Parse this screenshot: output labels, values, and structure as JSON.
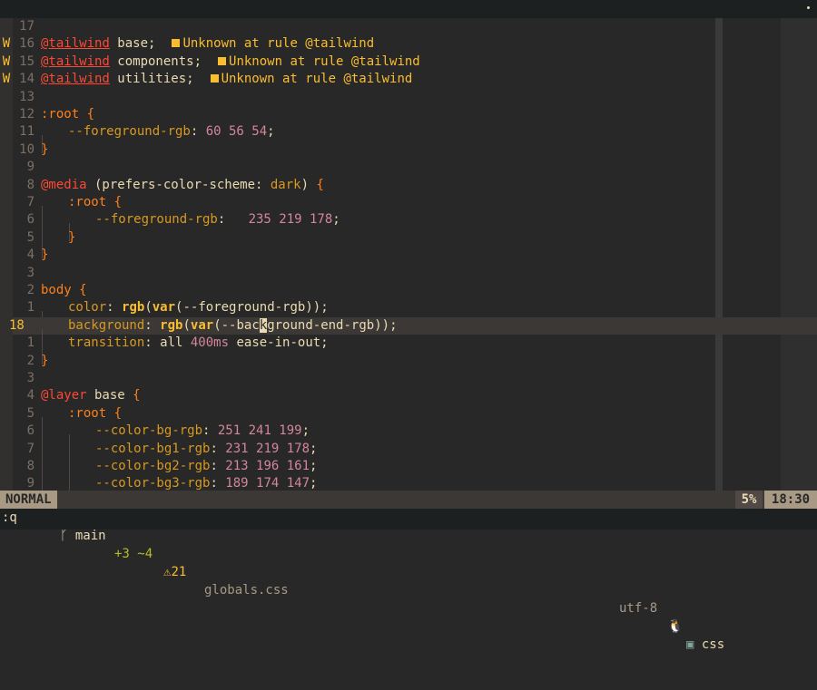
{
  "editor": {
    "lines": [
      {
        "sign": "",
        "num": "17",
        "cur": false,
        "segs": []
      },
      {
        "sign": "W",
        "num": "16",
        "cur": false,
        "segs": [
          {
            "c": "k-at u",
            "t": "@tailwind"
          },
          {
            "c": "k-plain",
            "t": " base;"
          }
        ],
        "diag": "Unknown at rule @tailwind"
      },
      {
        "sign": "W",
        "num": "15",
        "cur": false,
        "segs": [
          {
            "c": "k-at u",
            "t": "@tailwind"
          },
          {
            "c": "k-plain",
            "t": " components;"
          }
        ],
        "diag": "Unknown at rule @tailwind"
      },
      {
        "sign": "W",
        "num": "14",
        "cur": false,
        "segs": [
          {
            "c": "k-at u",
            "t": "@tailwind"
          },
          {
            "c": "k-plain",
            "t": " utilities;"
          }
        ],
        "diag": "Unknown at rule @tailwind"
      },
      {
        "sign": "",
        "num": "13",
        "cur": false,
        "segs": []
      },
      {
        "sign": "",
        "num": "12",
        "cur": false,
        "segs": [
          {
            "c": "k-sel",
            "t": ":root "
          },
          {
            "c": "k-brace",
            "t": "{"
          }
        ]
      },
      {
        "sign": "",
        "num": "11",
        "cur": false,
        "indent": 1,
        "segs": [
          {
            "c": "k-prop",
            "t": "--foreground-rgb"
          },
          {
            "c": "k-plain",
            "t": ": "
          },
          {
            "c": "k-num",
            "t": "60 56 54"
          },
          {
            "c": "k-plain",
            "t": ";"
          }
        ]
      },
      {
        "sign": "",
        "num": "10",
        "cur": false,
        "segs": [
          {
            "c": "k-brace",
            "t": "}"
          }
        ]
      },
      {
        "sign": "",
        "num": "9",
        "cur": false,
        "segs": []
      },
      {
        "sign": "",
        "num": "8",
        "cur": false,
        "segs": [
          {
            "c": "k-at",
            "t": "@media"
          },
          {
            "c": "k-plain",
            "t": " (prefers-color-scheme: "
          },
          {
            "c": "k-prop",
            "t": "dark"
          },
          {
            "c": "k-plain",
            "t": ") "
          },
          {
            "c": "k-brace",
            "t": "{"
          }
        ]
      },
      {
        "sign": "",
        "num": "7",
        "cur": false,
        "indent": 1,
        "segs": [
          {
            "c": "k-sel",
            "t": ":root "
          },
          {
            "c": "k-brace",
            "t": "{"
          }
        ]
      },
      {
        "sign": "",
        "num": "6",
        "cur": false,
        "indent": 2,
        "segs": [
          {
            "c": "k-prop",
            "t": "--foreground-rgb"
          },
          {
            "c": "k-plain",
            "t": ":   "
          },
          {
            "c": "k-num",
            "t": "235 219 178"
          },
          {
            "c": "k-plain",
            "t": ";"
          }
        ]
      },
      {
        "sign": "",
        "num": "5",
        "cur": false,
        "indent": 1,
        "segs": [
          {
            "c": "k-brace",
            "t": "}"
          }
        ]
      },
      {
        "sign": "",
        "num": "4",
        "cur": false,
        "segs": [
          {
            "c": "k-brace",
            "t": "}"
          }
        ]
      },
      {
        "sign": "",
        "num": "3",
        "cur": false,
        "segs": []
      },
      {
        "sign": "",
        "num": "2",
        "cur": false,
        "segs": [
          {
            "c": "k-sel",
            "t": "body "
          },
          {
            "c": "k-brace",
            "t": "{"
          }
        ]
      },
      {
        "sign": "",
        "num": "1",
        "cur": false,
        "indent": 1,
        "segs": [
          {
            "c": "k-prop",
            "t": "color"
          },
          {
            "c": "k-plain",
            "t": ": "
          },
          {
            "c": "k-fn",
            "t": "rgb"
          },
          {
            "c": "k-plain",
            "t": "("
          },
          {
            "c": "k-fn",
            "t": "var"
          },
          {
            "c": "k-plain",
            "t": "(--foreground-rgb));"
          }
        ]
      },
      {
        "sign": "",
        "num": "18",
        "cur": true,
        "indent": 1,
        "segs": [
          {
            "c": "k-prop",
            "t": "background"
          },
          {
            "c": "k-plain",
            "t": ": "
          },
          {
            "c": "k-fn",
            "t": "rgb"
          },
          {
            "c": "k-plain",
            "t": "("
          },
          {
            "c": "k-fn",
            "t": "var"
          },
          {
            "c": "k-plain",
            "t": "(--bac"
          },
          {
            "c": "cursor",
            "t": "k"
          },
          {
            "c": "k-plain",
            "t": "ground-end-rgb));"
          }
        ]
      },
      {
        "sign": "",
        "num": "1",
        "cur": false,
        "indent": 1,
        "segs": [
          {
            "c": "k-prop",
            "t": "transition"
          },
          {
            "c": "k-plain",
            "t": ": all "
          },
          {
            "c": "k-num",
            "t": "400ms"
          },
          {
            "c": "k-plain",
            "t": " ease-in-out;"
          }
        ]
      },
      {
        "sign": "",
        "num": "2",
        "cur": false,
        "segs": [
          {
            "c": "k-brace",
            "t": "}"
          }
        ]
      },
      {
        "sign": "",
        "num": "3",
        "cur": false,
        "segs": []
      },
      {
        "sign": "",
        "num": "4",
        "cur": false,
        "segs": [
          {
            "c": "k-at",
            "t": "@layer"
          },
          {
            "c": "k-plain",
            "t": " base "
          },
          {
            "c": "k-brace",
            "t": "{"
          }
        ]
      },
      {
        "sign": "",
        "num": "5",
        "cur": false,
        "indent": 1,
        "segs": [
          {
            "c": "k-sel",
            "t": ":root "
          },
          {
            "c": "k-brace",
            "t": "{"
          }
        ]
      },
      {
        "sign": "",
        "num": "6",
        "cur": false,
        "indent": 2,
        "segs": [
          {
            "c": "k-prop",
            "t": "--color-bg-rgb"
          },
          {
            "c": "k-plain",
            "t": ": "
          },
          {
            "c": "k-num",
            "t": "251 241 199"
          },
          {
            "c": "k-plain",
            "t": ";"
          }
        ]
      },
      {
        "sign": "",
        "num": "7",
        "cur": false,
        "indent": 2,
        "segs": [
          {
            "c": "k-prop",
            "t": "--color-bg1-rgb"
          },
          {
            "c": "k-plain",
            "t": ": "
          },
          {
            "c": "k-num",
            "t": "231 219 178"
          },
          {
            "c": "k-plain",
            "t": ";"
          }
        ]
      },
      {
        "sign": "",
        "num": "8",
        "cur": false,
        "indent": 2,
        "segs": [
          {
            "c": "k-prop",
            "t": "--color-bg2-rgb"
          },
          {
            "c": "k-plain",
            "t": ": "
          },
          {
            "c": "k-num",
            "t": "213 196 161"
          },
          {
            "c": "k-plain",
            "t": ";"
          }
        ]
      },
      {
        "sign": "",
        "num": "9",
        "cur": false,
        "indent": 2,
        "segs": [
          {
            "c": "k-prop",
            "t": "--color-bg3-rgb"
          },
          {
            "c": "k-plain",
            "t": ": "
          },
          {
            "c": "k-num",
            "t": "189 174 147"
          },
          {
            "c": "k-plain",
            "t": ";"
          }
        ]
      }
    ]
  },
  "statusline": {
    "mode": "NORMAL",
    "branch_icon": "git-branch-icon",
    "branch": "main",
    "diff": "+3 ~4",
    "warn_icon": "warning-icon",
    "warnings": "21",
    "filename": "globals.css",
    "encoding": "utf-8",
    "os_icon": "linux-icon",
    "filetype_icon": "css-icon",
    "filetype": "css",
    "percent": "5%",
    "time": "18:30"
  },
  "cmdline": ":q"
}
